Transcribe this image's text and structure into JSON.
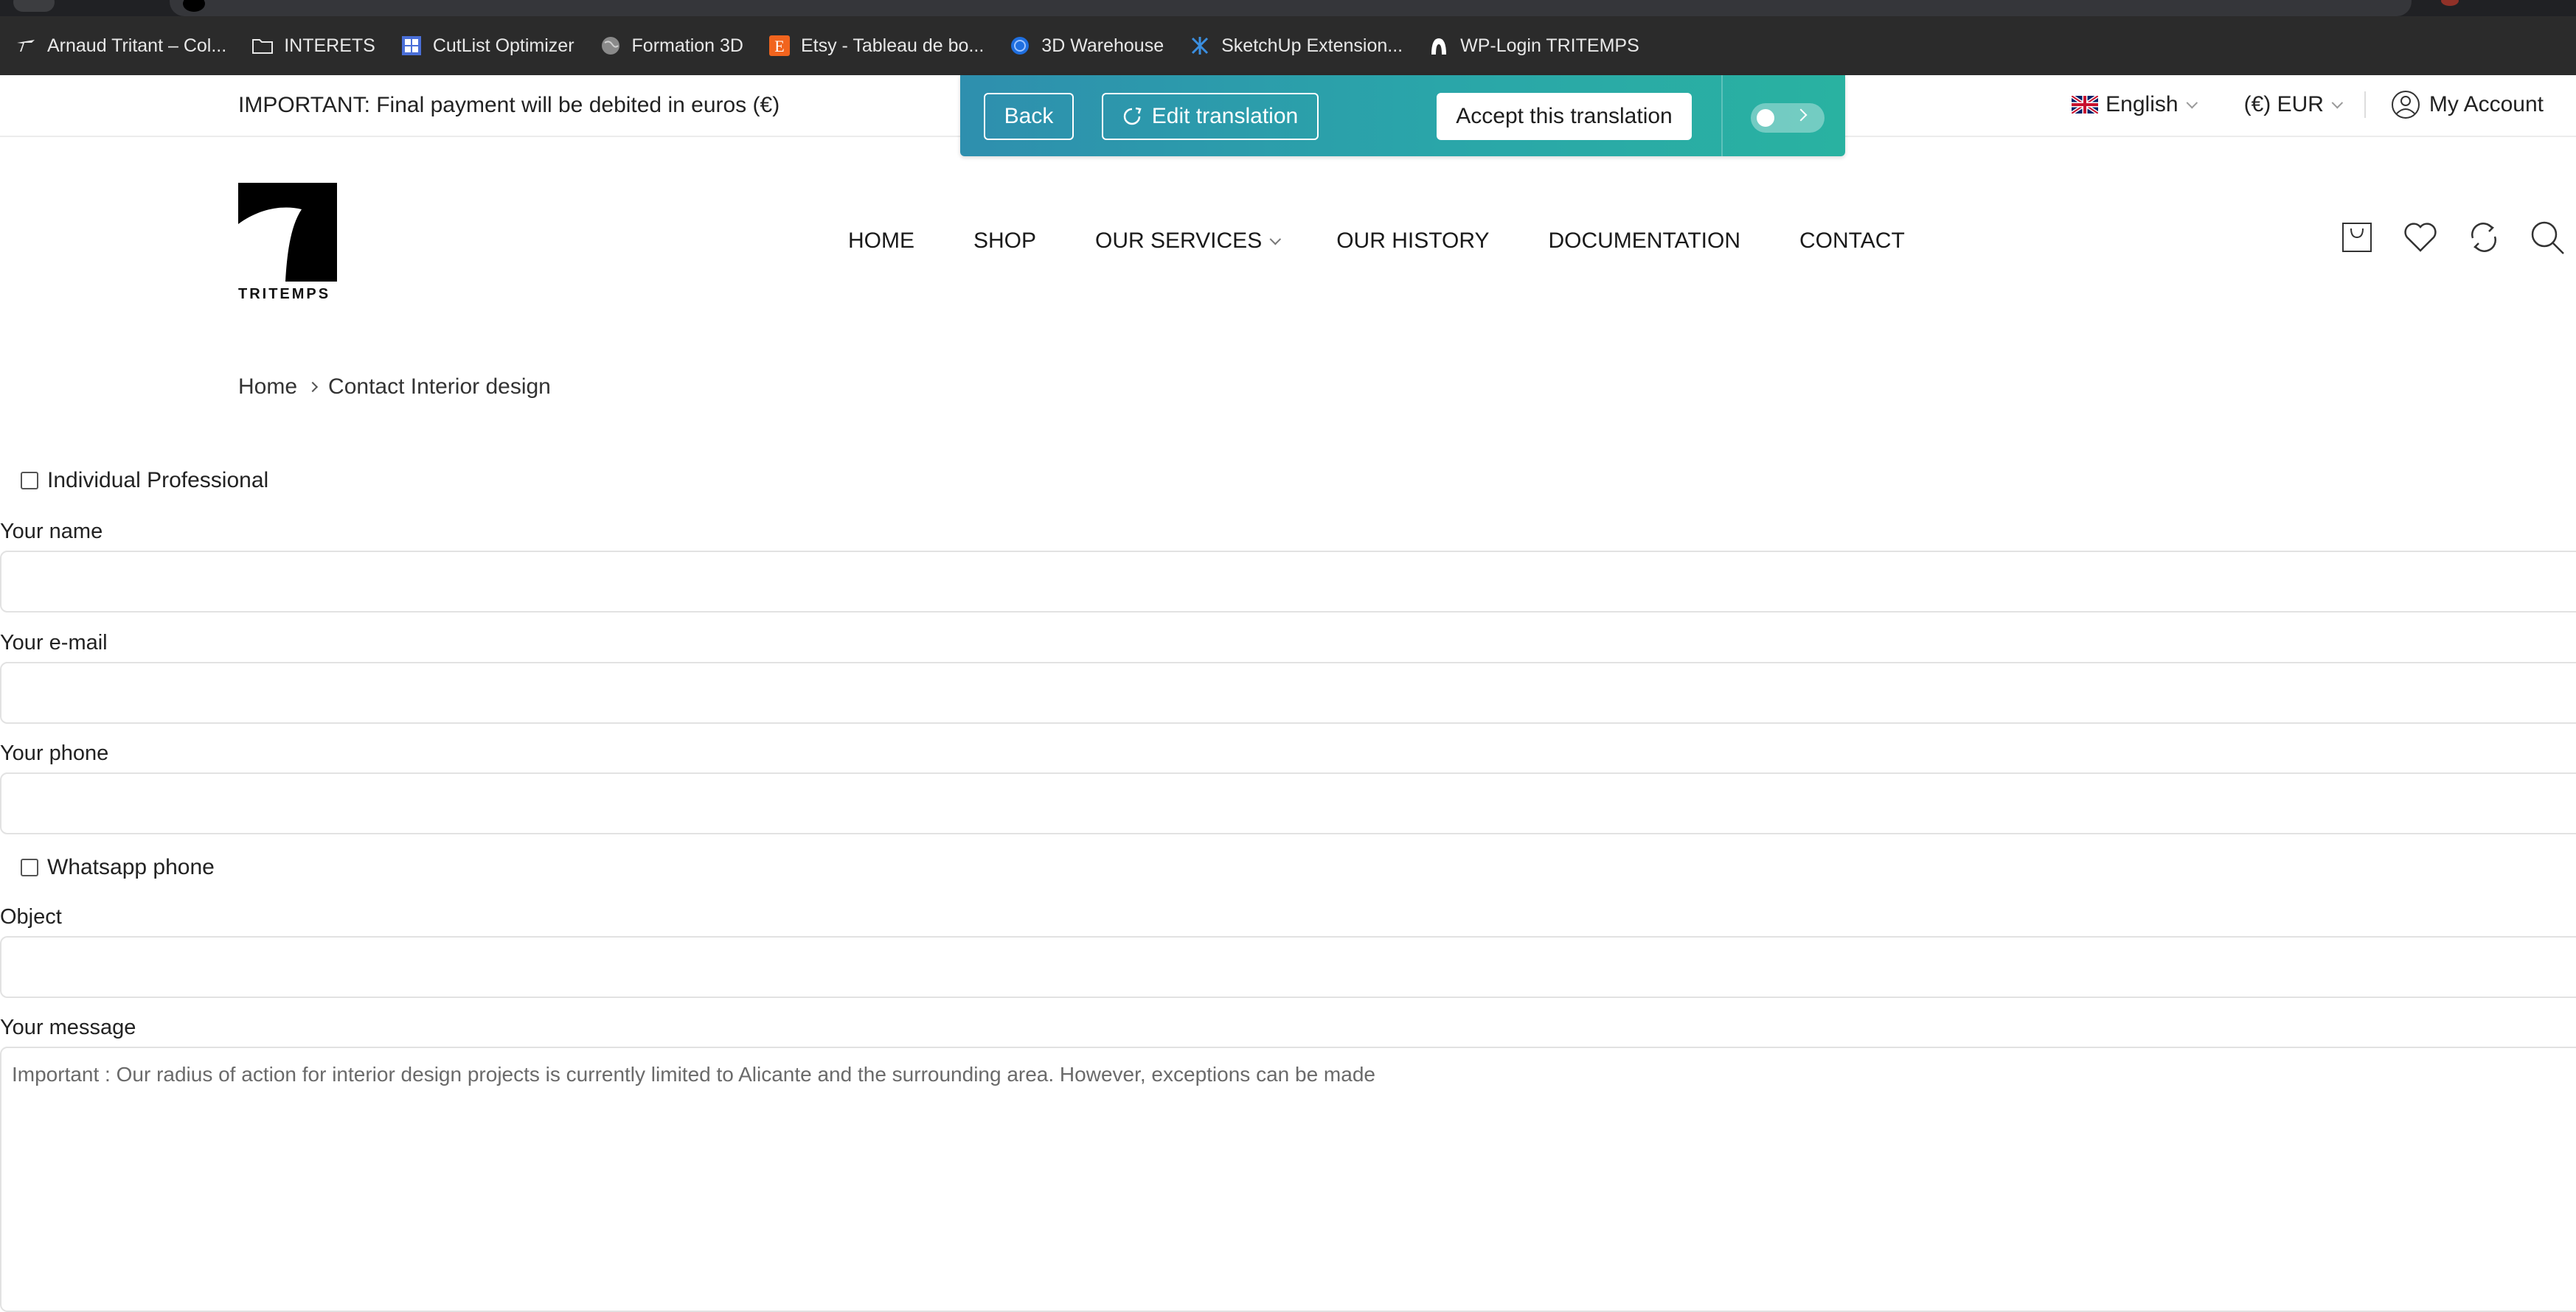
{
  "bookmarks": [
    {
      "label": "Arnaud Tritant – Col...",
      "icon": "brand-t-icon"
    },
    {
      "label": "INTERETS",
      "icon": "folder-icon"
    },
    {
      "label": "CutList Optimizer",
      "icon": "grid-app-icon"
    },
    {
      "label": "Formation 3D",
      "icon": "globe-icon"
    },
    {
      "label": "Etsy - Tableau de bo...",
      "icon": "etsy-icon"
    },
    {
      "label": "3D Warehouse",
      "icon": "warehouse-icon"
    },
    {
      "label": "SketchUp Extension...",
      "icon": "sketchup-icon"
    },
    {
      "label": "WP-Login TRITEMPS",
      "icon": "wp-login-icon"
    }
  ],
  "topbar": {
    "notice": "IMPORTANT: Final payment will be debited in euros (€)",
    "language": "English",
    "currency": "(€) EUR",
    "account": "My Account"
  },
  "translation": {
    "back": "Back",
    "edit": "Edit translation",
    "accept": "Accept this translation"
  },
  "logo": {
    "word": "TRITEMPS"
  },
  "nav": {
    "home": "HOME",
    "shop": "SHOP",
    "services": "OUR SERVICES",
    "history": "OUR HISTORY",
    "documentation": "DOCUMENTATION",
    "contact": "CONTACT"
  },
  "breadcrumb": {
    "home": "Home",
    "current": "Contact Interior design"
  },
  "form": {
    "customer_type": "Individual Professional",
    "name_label": "Your name",
    "email_label": "Your e-mail",
    "phone_label": "Your phone",
    "whatsapp_label": "Whatsapp phone",
    "object_label": "Object",
    "message_label": "Your message",
    "message_value": "Important : Our radius of action for interior design projects is currently limited to Alicante and the surrounding area. However, exceptions can be made"
  },
  "colors": {
    "panel_gradient_start": "#2e8fae",
    "panel_gradient_end": "#29b2a1",
    "bookmarks_bg": "#2b2b2b"
  }
}
